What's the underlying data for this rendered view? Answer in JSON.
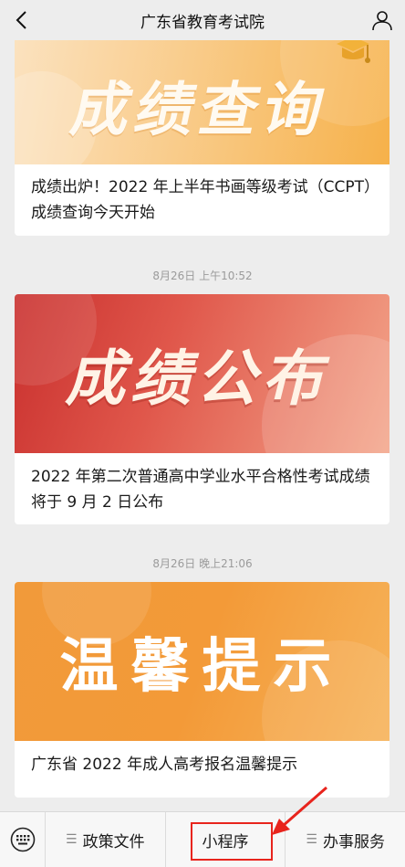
{
  "header": {
    "title": "广东省教育考试院",
    "back_icon": "chevron-left-icon",
    "profile_icon": "person-icon"
  },
  "feed": {
    "articles": [
      {
        "banner_text": "成绩查询",
        "caption": "成绩出炉！2022 年上半年书画等级考试（CCPT）成绩查询今天开始",
        "colors": {
          "banner_from": "#fbe2bf",
          "banner_to": "#f6b14a"
        }
      },
      {
        "timestamp": "8月26日 上午10:52",
        "banner_text": "成绩公布",
        "caption": "2022 年第二次普通高中学业水平合格性考试成绩将于 9 月 2 日公布",
        "colors": {
          "banner_from": "#c9302e",
          "banner_to": "#f3a58a"
        }
      },
      {
        "timestamp": "8月26日 晚上21:06",
        "banner_text": "温馨提示",
        "caption": "广东省 2022 年成人高考报名温馨提示",
        "colors": {
          "banner_from": "#f19a3a",
          "banner_to": "#f6b35a"
        }
      }
    ]
  },
  "bottom_menu": {
    "keyboard_icon": "keyboard-icon",
    "items": [
      {
        "label": "政策文件",
        "icon": "menu-lines-icon"
      },
      {
        "label": "小程序"
      },
      {
        "label": "办事服务",
        "icon": "menu-lines-icon"
      }
    ]
  },
  "annotation": {
    "color": "#e8241d"
  }
}
